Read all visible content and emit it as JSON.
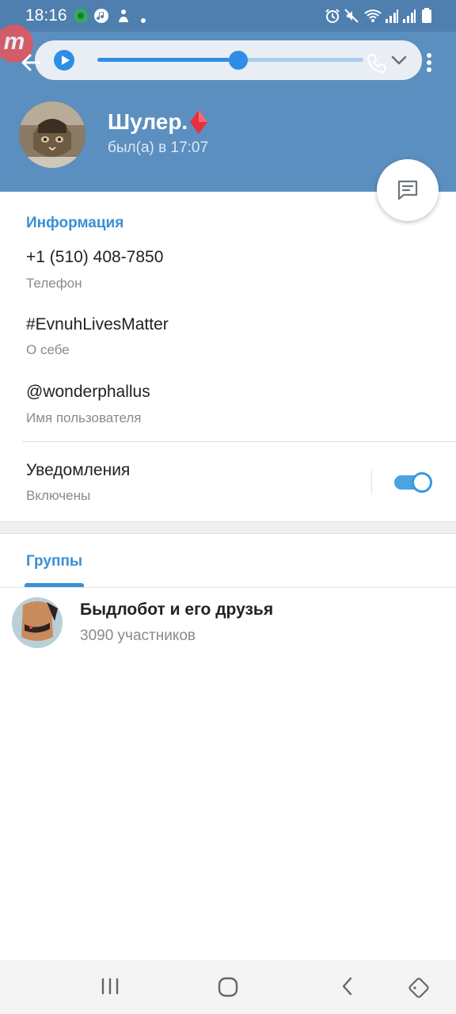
{
  "status_bar": {
    "time": "18:16"
  },
  "player": {
    "progress": 0.53
  },
  "profile": {
    "name": "Шулер.",
    "status": "был(а) в 17:07"
  },
  "info": {
    "section_title": "Информация",
    "phone": {
      "value": "+1 (510) 408-7850",
      "label": "Телефон"
    },
    "bio": {
      "value": "#EvnuhLivesMatter",
      "label": "О себе"
    },
    "username": {
      "value": "@wonderphallus",
      "label": "Имя пользователя"
    },
    "notifications": {
      "value": "Уведомления",
      "label": "Включены",
      "enabled": true
    }
  },
  "groups": {
    "tab_label": "Группы",
    "items": [
      {
        "name": "Быдлобот и его друзья",
        "members": "3090 участников"
      }
    ]
  },
  "colors": {
    "header": "#5b8fc0",
    "accent": "#3a8fd6",
    "player_accent": "#2e8de6"
  }
}
